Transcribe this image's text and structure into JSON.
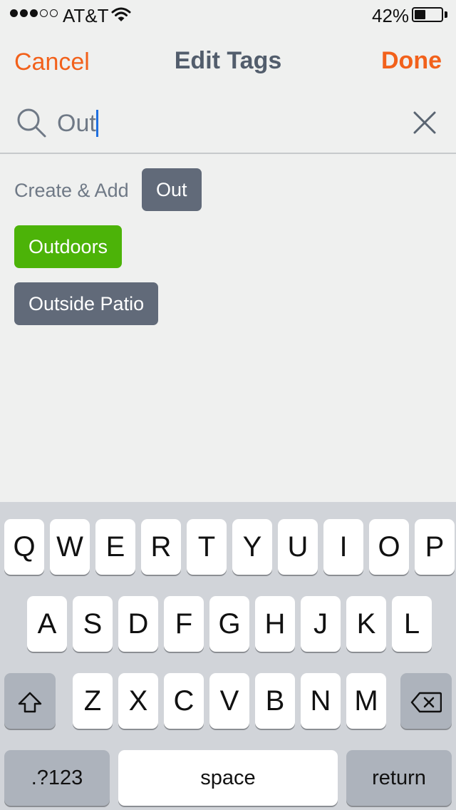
{
  "status": {
    "carrier": "AT&T",
    "battery_percent": "42%",
    "battery_level": 0.42,
    "signal_bars_filled": 3,
    "signal_bars_total": 5
  },
  "nav": {
    "cancel_label": "Cancel",
    "title": "Edit Tags",
    "done_label": "Done"
  },
  "search": {
    "value": "Out",
    "search_icon": "search-icon",
    "clear_icon": "close-icon"
  },
  "create": {
    "label": "Create & Add",
    "tag": "Out"
  },
  "tags": [
    {
      "label": "Outdoors",
      "color": "#4cb308"
    },
    {
      "label": "Outside Patio",
      "color": "#616a79"
    }
  ],
  "keyboard": {
    "row1": [
      "Q",
      "W",
      "E",
      "R",
      "T",
      "Y",
      "U",
      "I",
      "O",
      "P"
    ],
    "row2": [
      "A",
      "S",
      "D",
      "F",
      "G",
      "H",
      "J",
      "K",
      "L"
    ],
    "row3": [
      "Z",
      "X",
      "C",
      "V",
      "B",
      "N",
      "M"
    ],
    "shift_icon": "shift-icon",
    "delete_icon": "backspace-icon",
    "numbers_label": ".?123",
    "space_label": "space",
    "return_label": "return"
  },
  "colors": {
    "accent": "#f2611b",
    "title": "#525d6c",
    "tag_gray": "#616a79",
    "tag_green": "#4cb308",
    "cursor": "#1f6fe0"
  }
}
